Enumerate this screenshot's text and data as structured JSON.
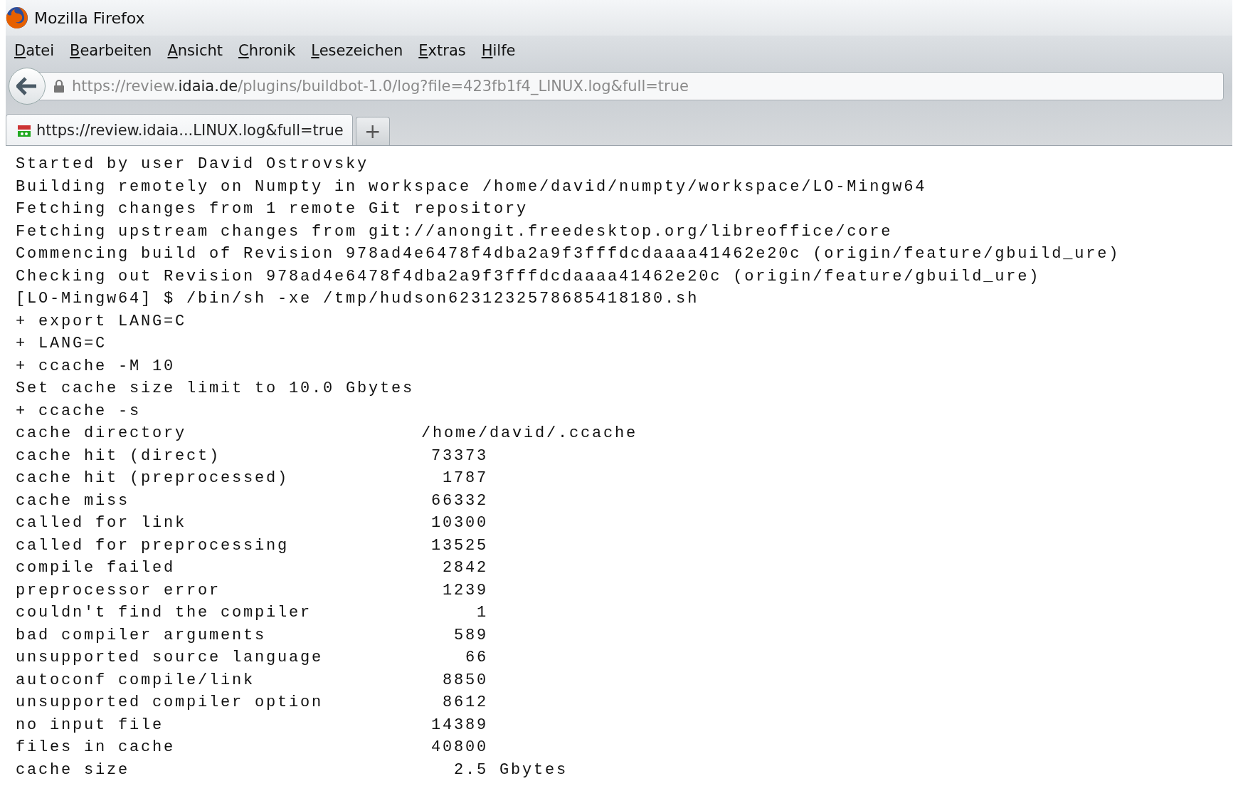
{
  "window": {
    "title": "Mozilla Firefox"
  },
  "menu": [
    {
      "label": "Datei"
    },
    {
      "label": "Bearbeiten"
    },
    {
      "label": "Ansicht"
    },
    {
      "label": "Chronik"
    },
    {
      "label": "Lesezeichen"
    },
    {
      "label": "Extras"
    },
    {
      "label": "Hilfe"
    }
  ],
  "address_bar": {
    "url": "https://review.**idaia.de**/plugins/buildbot-1.0/log?file=423fb1f4_LINUX.log&full=true"
  },
  "tabs": [
    {
      "title": "https://review.idaia...LINUX.log&full=true",
      "selected": true
    }
  ],
  "new_tab_button": "+",
  "log": [
    {
      "kind": "line",
      "text": "Started by user David Ostrovsky"
    },
    {
      "kind": "line",
      "text": "Building remotely on Numpty in workspace /home/david/numpty/workspace/LO-Mingw64"
    },
    {
      "kind": "line",
      "text": "Fetching changes from 1 remote Git repository"
    },
    {
      "kind": "line",
      "text": "Fetching upstream changes from git://anongit.freedesktop.org/libreoffice/core"
    },
    {
      "kind": "line",
      "text": "Commencing build of Revision 978ad4e6478f4dba2a9f3fffdcdaaaa41462e20c (origin/feature/gbuild_ure)"
    },
    {
      "kind": "line",
      "text": "Checking out Revision 978ad4e6478f4dba2a9f3fffdcdaaaa41462e20c (origin/feature/gbuild_ure)"
    },
    {
      "kind": "line",
      "text": "[LO-Mingw64] $ /bin/sh -xe /tmp/hudson6231232578685418180.sh"
    },
    {
      "kind": "line",
      "text": "+ export LANG=C"
    },
    {
      "kind": "line",
      "text": "+ LANG=C"
    },
    {
      "kind": "line",
      "text": "+ ccache -M 10"
    },
    {
      "kind": "line",
      "text": "Set cache size limit to 10.0 Gbytes"
    },
    {
      "kind": "line",
      "text": "+ ccache -s"
    },
    {
      "kind": "path",
      "label": "cache directory",
      "value": "/home/david/.ccache"
    },
    {
      "kind": "count",
      "label": "cache hit (direct)",
      "value": "73373"
    },
    {
      "kind": "count",
      "label": "cache hit (preprocessed)",
      "value": "1787"
    },
    {
      "kind": "count",
      "label": "cache miss",
      "value": "66332"
    },
    {
      "kind": "count",
      "label": "called for link",
      "value": "10300"
    },
    {
      "kind": "count",
      "label": "called for preprocessing",
      "value": "13525"
    },
    {
      "kind": "count",
      "label": "compile failed",
      "value": "2842"
    },
    {
      "kind": "count",
      "label": "preprocessor error",
      "value": "1239"
    },
    {
      "kind": "count",
      "label": "couldn't find the compiler",
      "value": "1"
    },
    {
      "kind": "count",
      "label": "bad compiler arguments",
      "value": "589"
    },
    {
      "kind": "count",
      "label": "unsupported source language",
      "value": "66"
    },
    {
      "kind": "count",
      "label": "autoconf compile/link",
      "value": "8850"
    },
    {
      "kind": "count",
      "label": "unsupported compiler option",
      "value": "8612"
    },
    {
      "kind": "count",
      "label": "no input file",
      "value": "14389"
    },
    {
      "kind": "count",
      "label": "files in cache",
      "value": "40800"
    },
    {
      "kind": "size",
      "label": "cache size",
      "value": "2.5",
      "unit": "Gbytes"
    }
  ]
}
